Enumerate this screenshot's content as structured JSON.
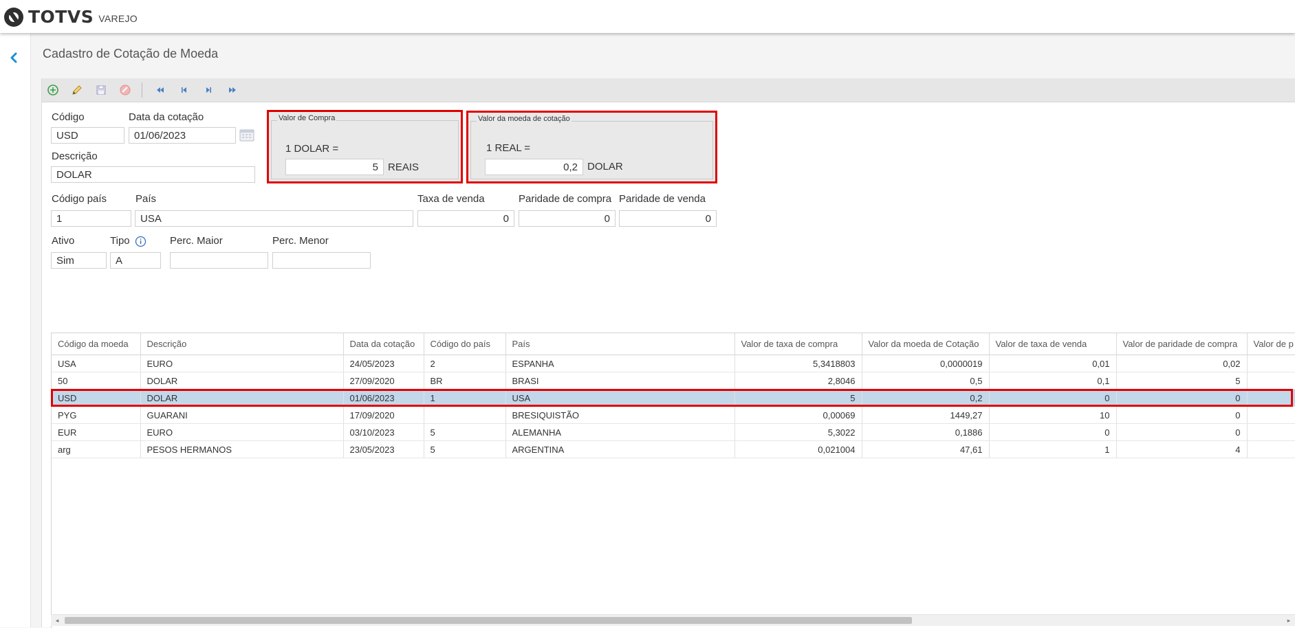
{
  "header": {
    "brand": "TOTVS",
    "product": "VAREJO"
  },
  "page": {
    "title": "Cadastro de Cotação de Moeda"
  },
  "toolbar": {
    "buttons": [
      "add-icon",
      "edit-icon",
      "save-icon",
      "cancel-icon",
      "first-record-icon",
      "previous-record-icon",
      "next-record-icon",
      "last-record-icon"
    ]
  },
  "form": {
    "codigo": {
      "label": "Código",
      "value": "USD"
    },
    "data_cotacao": {
      "label": "Data da cotação",
      "value": "01/06/2023"
    },
    "descricao": {
      "label": "Descrição",
      "value": "DOLAR"
    },
    "valor_compra": {
      "legend": "Valor de Compra",
      "equation": "1 DOLAR =",
      "value": "5",
      "unit": "REAIS"
    },
    "valor_moeda": {
      "legend": "Valor da moeda de cotação",
      "equation": "1 REAL =",
      "value": "0,2",
      "unit": "DOLAR"
    },
    "codigo_pais": {
      "label": "Código país",
      "value": "1"
    },
    "pais": {
      "label": "País",
      "value": "USA"
    },
    "taxa_venda": {
      "label": "Taxa de venda",
      "value": "0"
    },
    "paridade_compra": {
      "label": "Paridade de compra",
      "value": "0"
    },
    "paridade_venda": {
      "label": "Paridade de venda",
      "value": "0"
    },
    "ativo": {
      "label": "Ativo",
      "value": "Sim"
    },
    "tipo": {
      "label": "Tipo",
      "value": "A"
    },
    "perc_maior": {
      "label": "Perc. Maior",
      "value": ""
    },
    "perc_menor": {
      "label": "Perc. Menor",
      "value": ""
    }
  },
  "table": {
    "columns": [
      "Código da moeda",
      "Descrição",
      "Data da cotação",
      "Código do país",
      "País",
      "Valor de taxa de compra",
      "Valor da moeda de Cotação",
      "Valor de taxa de venda",
      "Valor de paridade de compra",
      "Valor de p"
    ],
    "rows": [
      [
        "USA",
        "EURO",
        "24/05/2023",
        "2",
        "ESPANHA",
        "5,3418803",
        "0,0000019",
        "0,01",
        "0,02",
        ""
      ],
      [
        "50",
        "DOLAR",
        "27/09/2020",
        "BR",
        "BRASI",
        "2,8046",
        "0,5",
        "0,1",
        "5",
        ""
      ],
      [
        "USD",
        "DOLAR",
        "01/06/2023",
        "1",
        "USA",
        "5",
        "0,2",
        "0",
        "0",
        ""
      ],
      [
        "PYG",
        "GUARANI",
        "17/09/2020",
        "",
        "BRESIQUISTÃO",
        "0,00069",
        "1449,27",
        "10",
        "0",
        ""
      ],
      [
        "EUR",
        "EURO",
        "03/10/2023",
        "5",
        "ALEMANHA",
        "5,3022",
        "0,1886",
        "0",
        "0",
        ""
      ],
      [
        "arg",
        "PESOS HERMANOS",
        "23/05/2023",
        "5",
        "ARGENTINA",
        "0,021004",
        "47,61",
        "1",
        "4",
        ""
      ]
    ],
    "selected_row": 2
  },
  "colors": {
    "highlight": "#e10000",
    "selected_row": "#c3d7ea",
    "back_arrow": "#1a8fd6"
  }
}
